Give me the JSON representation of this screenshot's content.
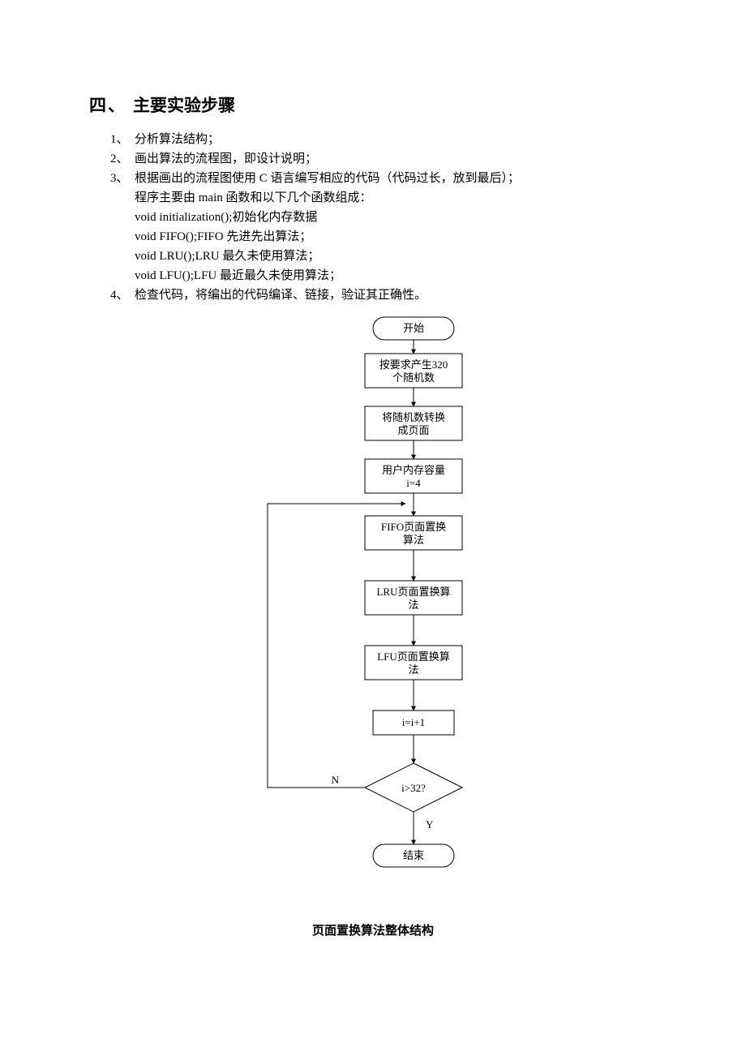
{
  "heading_number": "四、",
  "heading_text": "主要实验步骤",
  "steps": [
    {
      "marker": "1、",
      "text": "分析算法结构；"
    },
    {
      "marker": "2、",
      "text": "画出算法的流程图，即设计说明；"
    },
    {
      "marker": "3、",
      "text": "根据画出的流程图使用 C 语言编写相应的代码（代码过长，放到最后）；"
    }
  ],
  "step3_sub": [
    "程序主要由 main 函数和以下几个函数组成：",
    "void initialization();初始化内存数据",
    "void FIFO();FIFO 先进先出算法；",
    "void LRU();LRU 最久未使用算法；",
    "void LFU();LFU 最近最久未使用算法；"
  ],
  "step4": {
    "marker": "4、",
    "text": "检查代码，将编出的代码编译、链接，验证其正确性。"
  },
  "flow": {
    "start": "开始",
    "gen": "按要求产生320\n个随机数",
    "conv": "将随机数转换\n成页面",
    "init": "用户内存容量\ni=4",
    "fifo": "FIFO页面置换\n算法",
    "lru": "LRU页面置换算\n法",
    "lfu": "LFU页面置换算\n法",
    "inc": "i=i+1",
    "cond": "i>32?",
    "end": "结束",
    "no": "N",
    "yes": "Y"
  },
  "caption": "页面置换算法整体结构"
}
